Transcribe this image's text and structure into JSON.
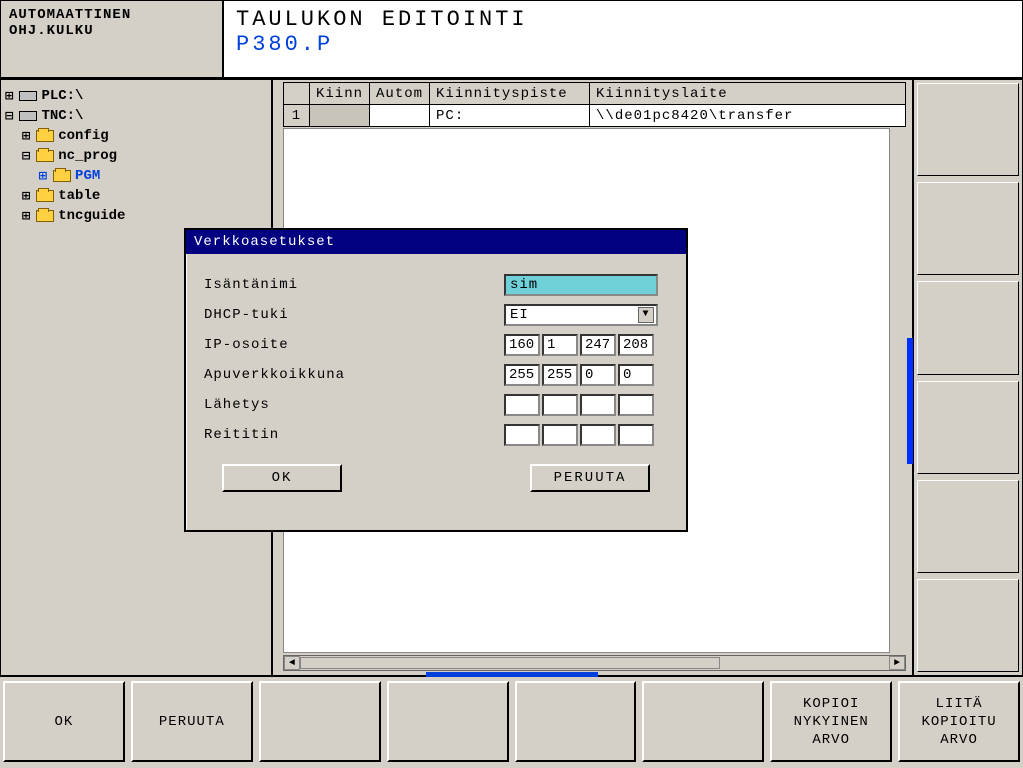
{
  "mode_box": {
    "line1": "AUTOMAATTINEN",
    "line2": "OHJ.KULKU"
  },
  "title": {
    "main": "TAULUKON EDITOINTI",
    "file": "P380.P"
  },
  "tree": {
    "plc": "PLC:\\",
    "tnc": "TNC:\\",
    "config": "config",
    "nc_prog": "nc_prog",
    "pgm": "PGM",
    "table": "table",
    "tncguide": "tncguide"
  },
  "table": {
    "headers": {
      "rownum": "",
      "kiinn": "Kiinn",
      "autom": "Autom",
      "piste": "Kiinnityspiste",
      "laite": "Kiinnityslaite"
    },
    "row1": {
      "num": "1",
      "kiinn": "",
      "autom": "",
      "piste": "PC:",
      "laite": "\\\\de01pc8420\\transfer"
    }
  },
  "dialog": {
    "title": "Verkkoasetukset",
    "hostname_label": "Isäntänimi",
    "hostname_value": "sim",
    "dhcp_label": "DHCP-tuki",
    "dhcp_value": "EI",
    "ip_label": "IP-osoite",
    "ip": {
      "a": "160",
      "b": "1",
      "c": "247",
      "d": "208"
    },
    "subnet_label": "Apuverkkoikkuna",
    "subnet": {
      "a": "255",
      "b": "255",
      "c": "0",
      "d": "0"
    },
    "broadcast_label": "Lähetys",
    "router_label": "Reititin",
    "ok": "OK",
    "cancel": "PERUUTA"
  },
  "softkeys": {
    "k1": "OK",
    "k2": "PERUUTA",
    "k3": "",
    "k4": "",
    "k5": "",
    "k6": "",
    "k7": "KOPIOI\nNYKYINEN\nARVO",
    "k8": "LIITÄ\nKOPIOITU\nARVO"
  }
}
